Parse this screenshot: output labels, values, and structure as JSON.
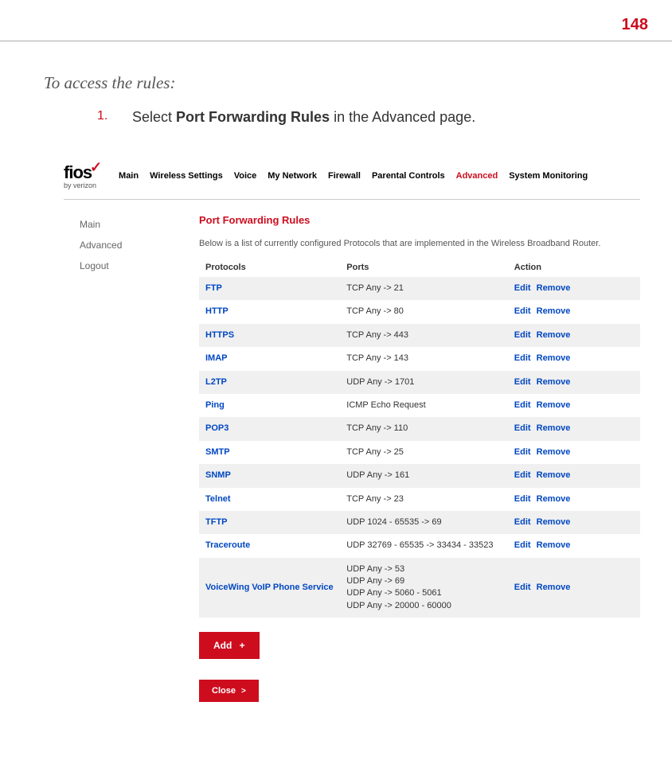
{
  "page_number": "148",
  "intro": "To access the rules:",
  "step": {
    "num": "1.",
    "prefix": "Select ",
    "bold": "Port Forwarding Rules",
    "suffix": " in the Advanced page."
  },
  "logo": {
    "main": "fios",
    "sub": "by verizon"
  },
  "topnav": [
    {
      "label": "Main",
      "active": false
    },
    {
      "label": "Wireless Settings",
      "active": false
    },
    {
      "label": "Voice",
      "active": false
    },
    {
      "label": "My Network",
      "active": false
    },
    {
      "label": "Firewall",
      "active": false
    },
    {
      "label": "Parental Controls",
      "active": false
    },
    {
      "label": "Advanced",
      "active": true
    },
    {
      "label": "System Monitoring",
      "active": false
    }
  ],
  "sidebar": [
    "Main",
    "Advanced",
    "Logout"
  ],
  "main": {
    "title": "Port Forwarding Rules",
    "description": "Below is a list of currently configured Protocols that are implemented in the Wireless Broadband Router.",
    "headers": {
      "protocols": "Protocols",
      "ports": "Ports",
      "action": "Action"
    },
    "edit_label": "Edit",
    "remove_label": "Remove",
    "add_label": "Add",
    "close_label": "Close",
    "rows": [
      {
        "protocol": "FTP",
        "ports": "TCP Any -> 21"
      },
      {
        "protocol": "HTTP",
        "ports": "TCP Any -> 80"
      },
      {
        "protocol": "HTTPS",
        "ports": "TCP Any -> 443"
      },
      {
        "protocol": "IMAP",
        "ports": "TCP Any -> 143"
      },
      {
        "protocol": "L2TP",
        "ports": "UDP Any -> 1701"
      },
      {
        "protocol": "Ping",
        "ports": "ICMP Echo Request"
      },
      {
        "protocol": "POP3",
        "ports": "TCP Any -> 110"
      },
      {
        "protocol": "SMTP",
        "ports": "TCP Any -> 25"
      },
      {
        "protocol": "SNMP",
        "ports": "UDP Any -> 161"
      },
      {
        "protocol": "Telnet",
        "ports": "TCP Any -> 23"
      },
      {
        "protocol": "TFTP",
        "ports": "UDP 1024 - 65535 -> 69"
      },
      {
        "protocol": "Traceroute",
        "ports": "UDP 32769 - 65535 -> 33434 - 33523"
      },
      {
        "protocol": "VoiceWing VoIP Phone Service",
        "ports": "UDP Any -> 53\nUDP Any -> 69\nUDP Any -> 5060 - 5061\nUDP Any -> 20000 - 60000"
      }
    ]
  }
}
